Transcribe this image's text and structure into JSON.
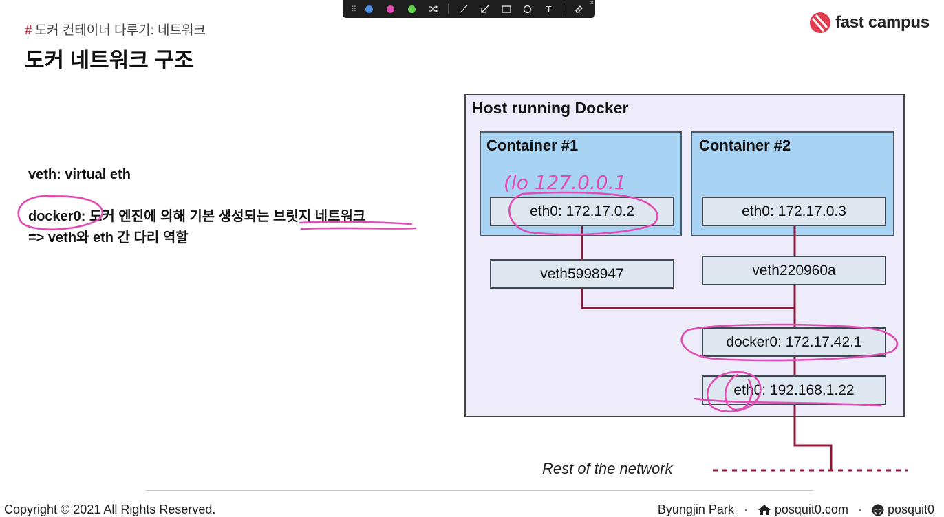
{
  "toolbar": {
    "tools": [
      "blue-pen",
      "pink-pen",
      "green-pen",
      "shuffle",
      "line",
      "arrow",
      "rectangle",
      "ellipse",
      "text",
      "eraser"
    ],
    "colors": {
      "blue": "#4a90e2",
      "pink": "#e04bb4",
      "green": "#5ecf48"
    },
    "text_tool": "T"
  },
  "header": {
    "breadcrumb_hash": "#",
    "breadcrumb": "도커 컨테이너 다루기: 네트워크",
    "title": "도커 네트워크 구조"
  },
  "logo": {
    "text": "fast campus",
    "color": "#e03c4e"
  },
  "body": {
    "veth_line": "veth: virtual eth",
    "docker0_term": "docker0:",
    "docker0_desc_a": " 도커 엔진에 의해 기본 생성되는 ",
    "docker0_desc_b": "브릿지 네트워크",
    "bridge_line": "=> veth와 eth 간 다리 역할"
  },
  "diagram": {
    "host_title": "Host running Docker",
    "container1": {
      "title": "Container #1",
      "eth0": "eth0: 172.17.0.2",
      "veth": "veth5998947"
    },
    "container2": {
      "title": "Container #2",
      "eth0": "eth0: 172.17.0.3",
      "veth": "veth220960a"
    },
    "docker0": "docker0: 172.17.42.1",
    "host_eth0": "eth0: 192.168.1.22",
    "rest_of_network": "Rest of the network",
    "colors": {
      "host_bg": "#eeecfb",
      "container_bg": "#a9d3f3",
      "iface_bg": "#dfe8f1",
      "link": "#8b1a3a"
    }
  },
  "annotations": {
    "handwritten": "(lo 127.0.0.1",
    "ink_color": "#e04bb4"
  },
  "footer": {
    "copyright": "Copyright © 2021 All Rights Reserved.",
    "author": "Byungjin Park",
    "separator": "·",
    "website": "posquit0.com",
    "github": "posquit0"
  }
}
